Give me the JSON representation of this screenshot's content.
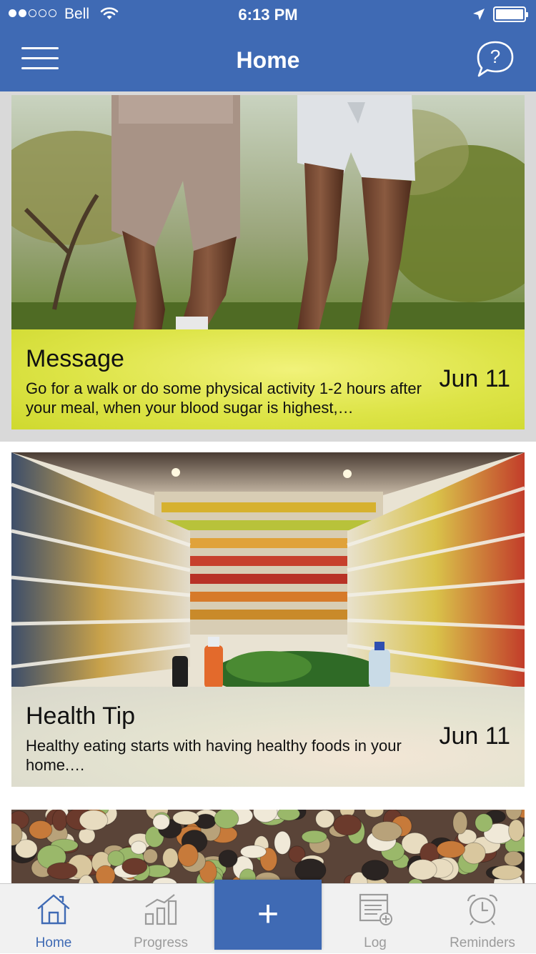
{
  "status_bar": {
    "carrier": "Bell",
    "time": "6:13 PM",
    "signal_bars_filled": 2,
    "signal_bars_total": 5,
    "battery_level": 1.0
  },
  "nav": {
    "title": "Home",
    "menu_icon": "hamburger-menu-icon",
    "help_icon": "help-chat-icon"
  },
  "feed": [
    {
      "title": "Message",
      "body": "Go for a walk or do some physical activity 1-2 hours after your meal, when your blood sugar is highest,…",
      "date": "Jun 11",
      "image": "people-running-photo"
    },
    {
      "title": "Health Tip",
      "body": "Healthy eating starts with having healthy foods in your home.…",
      "date": "Jun 11",
      "image": "grocery-aisle-photo"
    },
    {
      "image": "beans-legumes-photo"
    }
  ],
  "tabbar": {
    "items": [
      {
        "label": "Home",
        "icon": "home-icon"
      },
      {
        "label": "Progress",
        "icon": "bar-chart-icon"
      },
      {
        "label": "Log",
        "icon": "log-add-icon"
      },
      {
        "label": "Reminders",
        "icon": "alarm-clock-icon"
      }
    ],
    "add_label": "+",
    "active_tab": "Home",
    "colors": {
      "accent": "#3f6ab4",
      "inactive": "#9b9b9b"
    }
  }
}
